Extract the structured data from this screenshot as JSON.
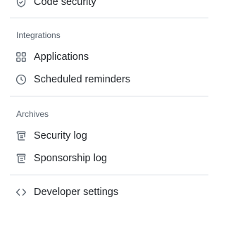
{
  "top_item": {
    "label": "Code security",
    "icon": "shield-check-icon"
  },
  "integrations": {
    "heading": "Integrations",
    "items": [
      {
        "label": "Applications",
        "icon": "apps-icon"
      },
      {
        "label": "Scheduled reminders",
        "icon": "clock-icon"
      }
    ]
  },
  "archives": {
    "heading": "Archives",
    "items": [
      {
        "label": "Security log",
        "icon": "log-icon"
      },
      {
        "label": "Sponsorship log",
        "icon": "log-icon"
      }
    ]
  },
  "developer": {
    "label": "Developer settings",
    "icon": "code-icon"
  }
}
